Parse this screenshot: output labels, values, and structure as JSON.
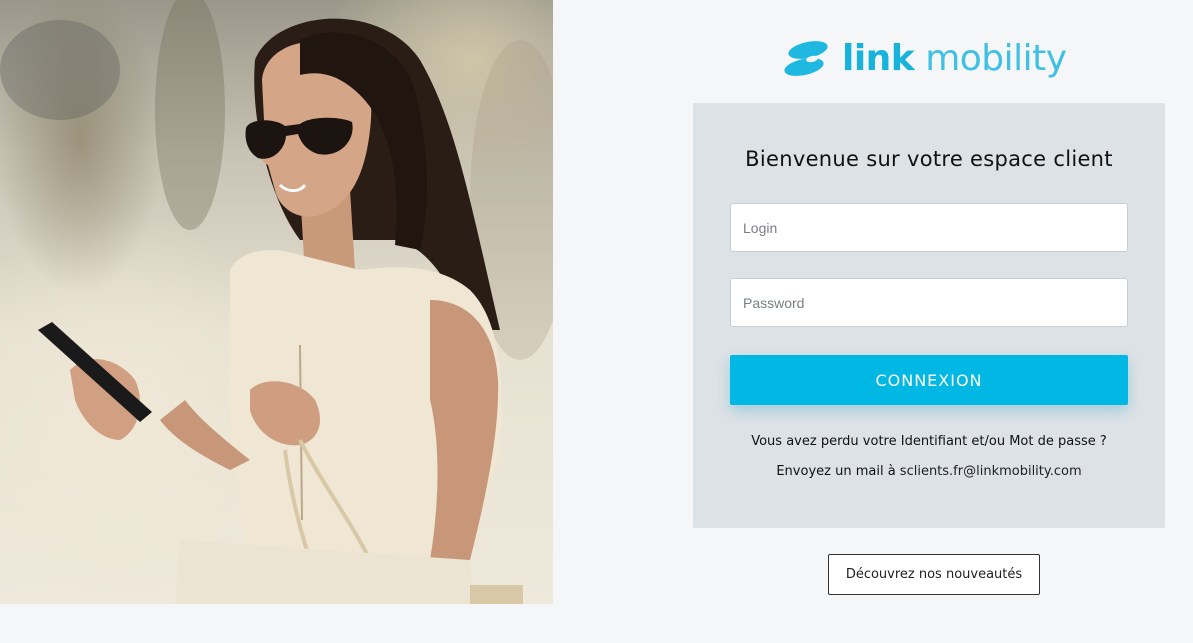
{
  "brand": {
    "logo_bold": "link",
    "logo_light": " mobility",
    "color": "#1fb8e0"
  },
  "hero": {
    "icon": "woman-with-phone-and-shopping-bag-photo"
  },
  "login": {
    "title": "Bienvenue sur votre espace client",
    "login_placeholder": "Login",
    "password_placeholder": "Password",
    "login_value": "",
    "password_value": "",
    "submit_label": "CONNEXION",
    "submit_color": "#00b8e3",
    "lost_text": "Vous avez perdu votre Identifiant et/ou Mot de passe ?",
    "mail_prefix": "Envoyez un mail à ",
    "mail_address": "sclients.fr@linkmobility.com"
  },
  "footer": {
    "discover_label": "Découvrez nos nouveautés"
  }
}
